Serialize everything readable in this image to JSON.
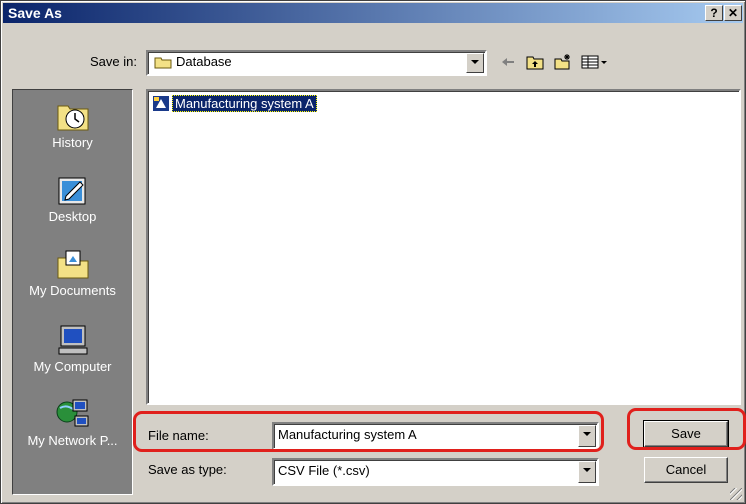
{
  "window": {
    "title": "Save As",
    "help_btn": "?",
    "close_btn": "✕"
  },
  "save_in": {
    "label": "Save in:",
    "value": "Database",
    "folder_icon": "folder-icon"
  },
  "toolbar": [
    "back-arrow-icon",
    "up-folder-icon",
    "new-folder-icon",
    "view-menu-icon"
  ],
  "places": [
    {
      "label": "History",
      "icon": "history-icon"
    },
    {
      "label": "Desktop",
      "icon": "desktop-icon"
    },
    {
      "label": "My Documents",
      "icon": "my-documents-icon"
    },
    {
      "label": "My Computer",
      "icon": "my-computer-icon"
    },
    {
      "label": "My Network P...",
      "icon": "network-places-icon"
    }
  ],
  "files": [
    {
      "name": "Manufacturing system A",
      "icon": "database-file-icon"
    }
  ],
  "file_name": {
    "label": "File name:",
    "value": "Manufacturing system A"
  },
  "save_type": {
    "label": "Save as type:",
    "value": "CSV File (*.csv)"
  },
  "buttons": {
    "save": "Save",
    "cancel": "Cancel"
  },
  "colors": {
    "title_start": "#0a246a",
    "title_end": "#a6caf0",
    "highlight": "#e0201c",
    "face": "#d4d0c8"
  }
}
